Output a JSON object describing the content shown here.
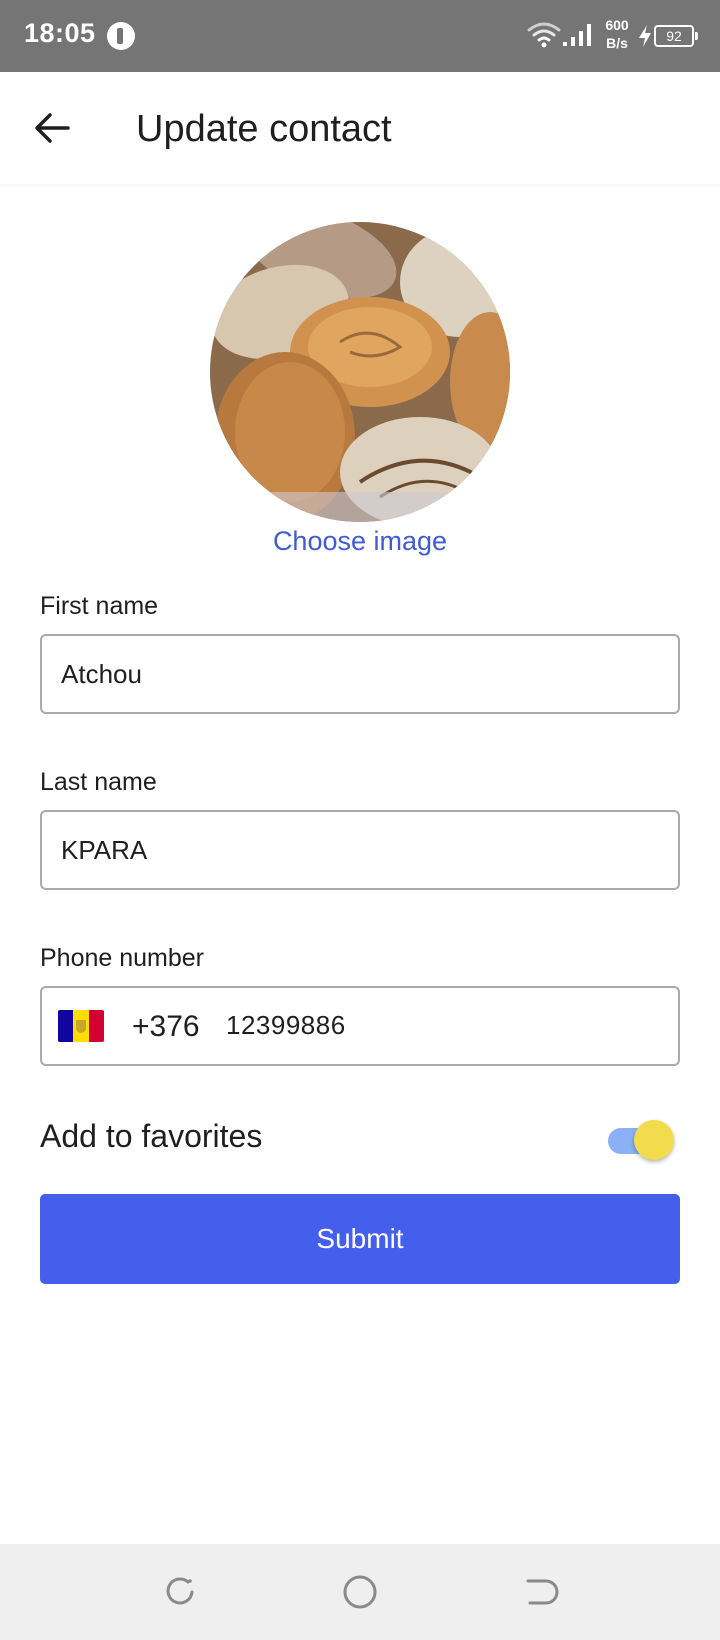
{
  "status_bar": {
    "time": "18:05",
    "network_speed_value": "600",
    "network_speed_unit": "B/s",
    "battery_level": "92",
    "icons": [
      "app-notification-icon",
      "wifi-icon",
      "signal-icon",
      "charging-bolt-icon",
      "battery-icon"
    ]
  },
  "app_bar": {
    "title": "Update contact",
    "back_icon": "arrow-left-icon"
  },
  "avatar": {
    "choose_image_label": "Choose image"
  },
  "form": {
    "first_name": {
      "label": "First name",
      "value": "Atchou"
    },
    "last_name": {
      "label": "Last name",
      "value": "KPARA"
    },
    "phone": {
      "label": "Phone number",
      "country_flag": "andorra-flag-icon",
      "dial_code": "+376",
      "value": "12399886"
    },
    "favorites": {
      "label": "Add to favorites",
      "enabled": true
    },
    "submit_label": "Submit"
  },
  "nav_bar": {
    "icons": [
      "recents-icon",
      "home-icon",
      "back-icon"
    ]
  },
  "colors": {
    "accent": "#445fec",
    "link": "#3f5bd6",
    "status_bar": "#757575",
    "toggle_track": "#8ab0f5",
    "toggle_thumb": "#f2dc4d",
    "andorra_blue": "#10069f",
    "andorra_yellow": "#fedd00",
    "andorra_red": "#d50032"
  }
}
